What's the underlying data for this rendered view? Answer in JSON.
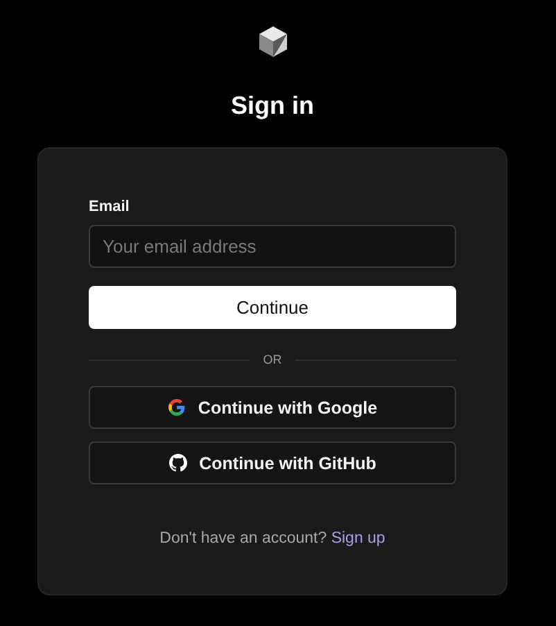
{
  "title": "Sign in",
  "form": {
    "email_label": "Email",
    "email_placeholder": "Your email address",
    "submit": "Continue"
  },
  "divider": "OR",
  "social_buttons": [
    {
      "kind": "google",
      "label": "Continue with Google"
    },
    {
      "kind": "github",
      "label": "Continue with GitHub"
    }
  ],
  "footer": {
    "text": "Don't have an account?",
    "link": "Sign up"
  }
}
